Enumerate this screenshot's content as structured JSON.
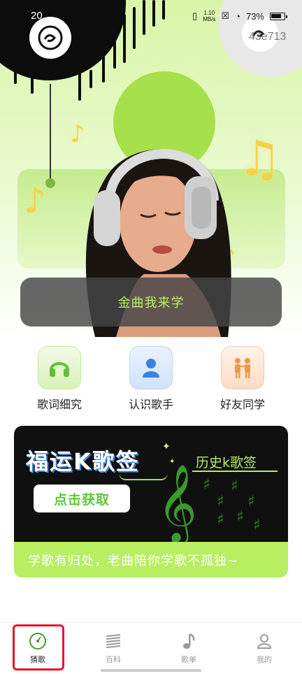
{
  "status_bar": {
    "time": "20",
    "network_speed_value": "1.10",
    "network_speed_unit": "MB/s",
    "battery_percent": "73%"
  },
  "hero": {
    "watermark": "43e713",
    "banner_text": "金曲我来学"
  },
  "features": [
    {
      "label": "歌词细究",
      "icon": "headphones-icon",
      "color": "#5fbf3a"
    },
    {
      "label": "认识歌手",
      "icon": "person-icon",
      "color": "#3b82e0"
    },
    {
      "label": "好友同学",
      "icon": "two-people-icon",
      "color": "#e89a4a"
    }
  ],
  "promo": {
    "title": "福运K歌签",
    "button_label": "点击获取",
    "history_label": "历史k歌签",
    "slogan": "学歌有归处，老曲陪你学歌不孤独~"
  },
  "tabs": [
    {
      "label": "猜歌",
      "icon": "gauge-icon",
      "active": true
    },
    {
      "label": "百科",
      "icon": "encyclopedia-icon",
      "active": false
    },
    {
      "label": "歌单",
      "icon": "music-note-icon",
      "active": false
    },
    {
      "label": "我的",
      "icon": "profile-icon",
      "active": false
    }
  ],
  "colors": {
    "accent_green": "#b7ee62",
    "banner_text": "#b9f06a",
    "active_tab_outline": "#e0182a"
  }
}
